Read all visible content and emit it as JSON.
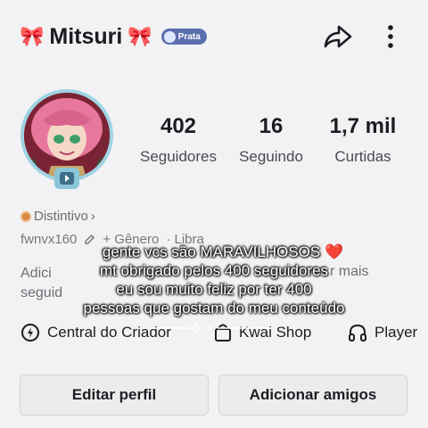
{
  "header": {
    "bow_left": "🎀",
    "username": "Mitsuri",
    "bow_right": "🎀",
    "badge_label": "Prata",
    "share_icon": "share-arrow-icon",
    "more_icon": "more-vertical-icon"
  },
  "stats": [
    {
      "value": "402",
      "label": "Seguidores"
    },
    {
      "value": "16",
      "label": "Seguindo"
    },
    {
      "value": "1,7 mil",
      "label": "Curtidas"
    }
  ],
  "profile": {
    "distinctive_label": "Distintivo",
    "distinctive_chevron": "›",
    "handle": "fwnvx160",
    "gender_label": "+ Gênero",
    "sign_label": "· Libra",
    "bio_line1": "Adici",
    "bio_line2": "seguid",
    "bio_more": "r mais"
  },
  "caption": {
    "line1": "gente vcs são MARAVILHOSOS",
    "heart": "❤️",
    "line2": "mt obrigado pelos 400 seguidores",
    "line3": "eu sou muito feliz por ter 400",
    "line4": "pessoas que gostam do meu conteúdo"
  },
  "links": {
    "creator_label": "Central do Criador",
    "shop_label": "Kwai Shop",
    "player_label": "Player"
  },
  "buttons": {
    "edit_label": "Editar perfil",
    "add_label": "Adicionar amigos"
  },
  "colors": {
    "background": "#f2f2f4",
    "badge": "#5a6fae",
    "heart": "#e8222e",
    "avatar_border": "#9fd3e2"
  }
}
